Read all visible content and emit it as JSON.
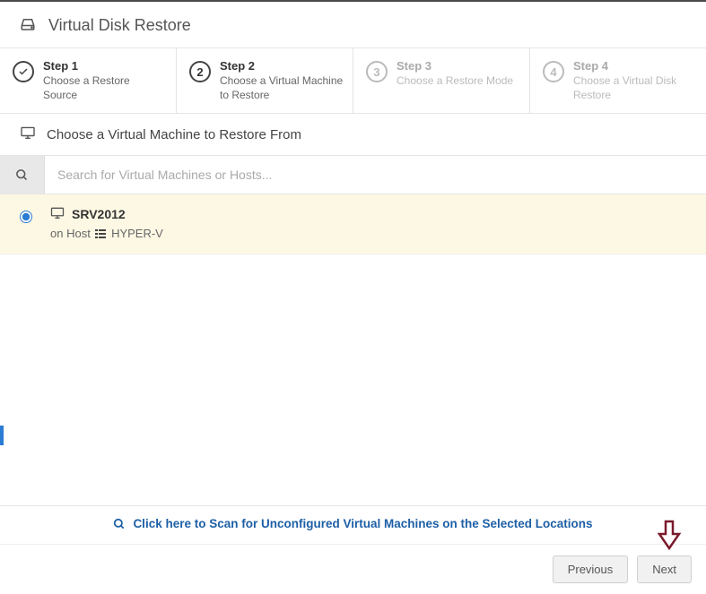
{
  "header": {
    "title": "Virtual Disk Restore"
  },
  "steps": [
    {
      "number": "1",
      "label": "Step 1",
      "desc": "Choose a Restore Source",
      "state": "completed"
    },
    {
      "number": "2",
      "label": "Step 2",
      "desc": "Choose a Virtual Machine to Restore",
      "state": "active"
    },
    {
      "number": "3",
      "label": "Step 3",
      "desc": "Choose a Restore Mode",
      "state": "inactive"
    },
    {
      "number": "4",
      "label": "Step 4",
      "desc": "Choose a Virtual Disk Restore",
      "state": "inactive"
    }
  ],
  "section": {
    "title": "Choose a Virtual Machine to Restore From"
  },
  "search": {
    "placeholder": "Search for Virtual Machines or Hosts..."
  },
  "vms": [
    {
      "name": "SRV2012",
      "host_prefix": "on Host",
      "host_name": "HYPER-V",
      "selected": true
    }
  ],
  "scan": {
    "label": "Click here to Scan for Unconfigured Virtual Machines on the Selected Locations"
  },
  "footer": {
    "prev": "Previous",
    "next": "Next"
  }
}
